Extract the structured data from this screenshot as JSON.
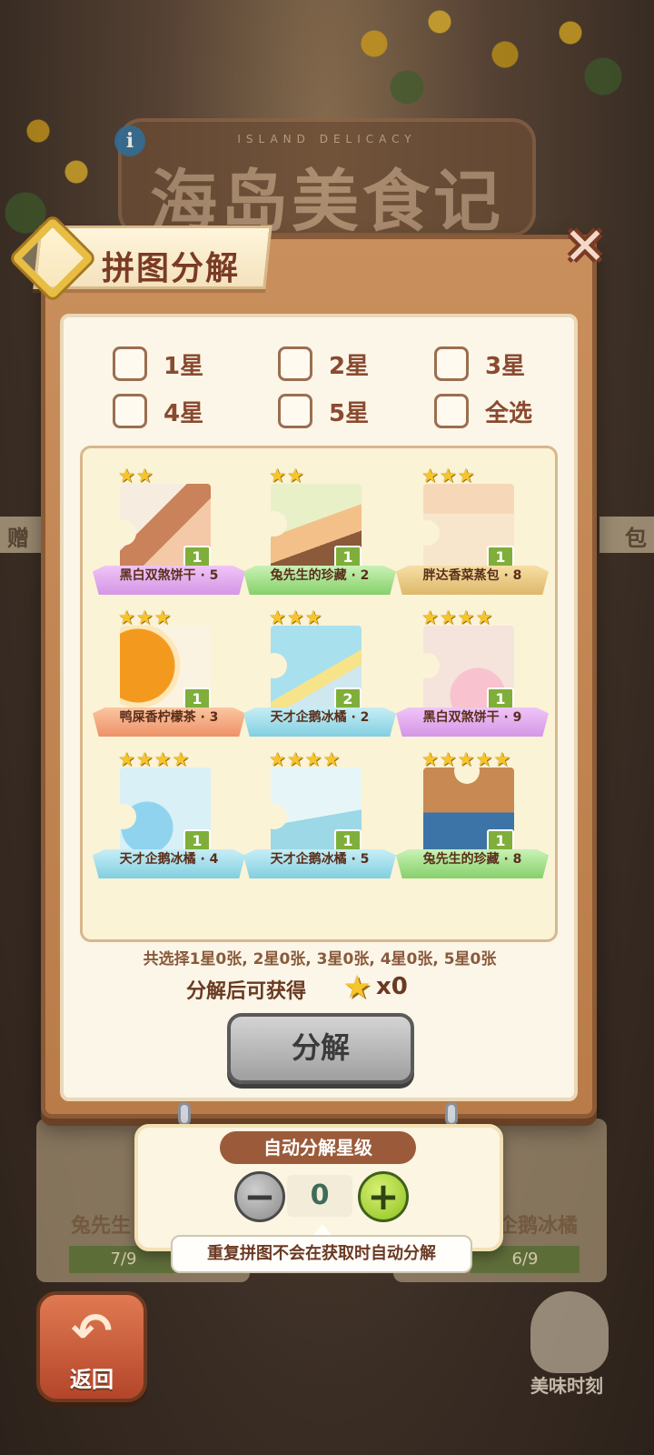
{
  "background": {
    "logo_subtitle": "ISLAND DELICACY",
    "logo_title": "海岛美食记",
    "side_left_text": "赠",
    "side_right_text": "包",
    "card_left_label": "兔先生",
    "card_right_label": "企鹅冰橘",
    "progress_left": "7/9",
    "progress_right": "6/9",
    "back_label": "返回",
    "mascot_label": "美味时刻"
  },
  "dialog": {
    "title": "拼图分解",
    "close_icon": "close-icon",
    "filters": [
      {
        "label": "1星"
      },
      {
        "label": "2星"
      },
      {
        "label": "3星"
      },
      {
        "label": "4星"
      },
      {
        "label": "5星"
      },
      {
        "label": "全选"
      }
    ],
    "cards": [
      {
        "name": "黑白双煞饼干 · 5",
        "stars": 2,
        "count": "1",
        "color": "purple"
      },
      {
        "name": "兔先生的珍藏 · 2",
        "stars": 2,
        "count": "1",
        "color": "green"
      },
      {
        "name": "胖达香菜蒸包 · 8",
        "stars": 3,
        "count": "1",
        "color": "tan"
      },
      {
        "name": "鸭屎香柠檬茶 · 3",
        "stars": 3,
        "count": "1",
        "color": "orange"
      },
      {
        "name": "天才企鹅冰橘 · 2",
        "stars": 3,
        "count": "2",
        "color": "blue"
      },
      {
        "name": "黑白双煞饼干 · 9",
        "stars": 4,
        "count": "1",
        "color": "purple"
      },
      {
        "name": "天才企鹅冰橘 · 4",
        "stars": 4,
        "count": "1",
        "color": "blue"
      },
      {
        "name": "天才企鹅冰橘 · 5",
        "stars": 4,
        "count": "1",
        "color": "blue"
      },
      {
        "name": "兔先生的珍藏 · 8",
        "stars": 5,
        "count": "1",
        "color": "green"
      }
    ],
    "summary": "共选择1星0张, 2星0张, 3星0张, 4星0张, 5星0张",
    "reward_label": "分解后可获得",
    "reward_count": "x0",
    "decompose_label": "分解"
  },
  "auto_panel": {
    "header": "自动分解星级",
    "minus": "−",
    "value": "0",
    "plus": "+",
    "tooltip": "重复拼图不会在获取时自动分解"
  },
  "colors": {
    "star": "#f7c52a",
    "count_badge": "#7fae3a",
    "title_text": "#7a3b24"
  }
}
